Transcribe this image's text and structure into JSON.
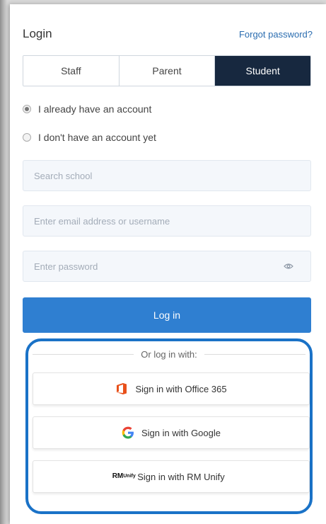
{
  "header": {
    "title": "Login",
    "forgot_password": "Forgot password?"
  },
  "tabs": [
    {
      "label": "Staff",
      "active": false
    },
    {
      "label": "Parent",
      "active": false
    },
    {
      "label": "Student",
      "active": true
    }
  ],
  "account_options": [
    {
      "label": "I already have an account",
      "checked": true
    },
    {
      "label": "I don't have an account yet",
      "checked": false
    }
  ],
  "fields": {
    "school": {
      "placeholder": "Search school",
      "value": ""
    },
    "username": {
      "placeholder": "Enter email address or username",
      "value": ""
    },
    "password": {
      "placeholder": "Enter password",
      "value": ""
    }
  },
  "login_button": "Log in",
  "alt_login": {
    "divider_text": "Or log in with:",
    "providers": [
      {
        "label": "Sign in with Office 365",
        "icon": "office365-icon"
      },
      {
        "label": "Sign in with Google",
        "icon": "google-icon"
      },
      {
        "label": "Sign in with RM Unify",
        "icon": "rm-unify-icon"
      }
    ],
    "rm_logo_text": "RM",
    "rm_logo_subtext": "Unify"
  },
  "colors": {
    "primary": "#2f7fd1",
    "active_tab": "#17283f",
    "link": "#2b6db0",
    "highlight_border": "#1a72c7"
  }
}
